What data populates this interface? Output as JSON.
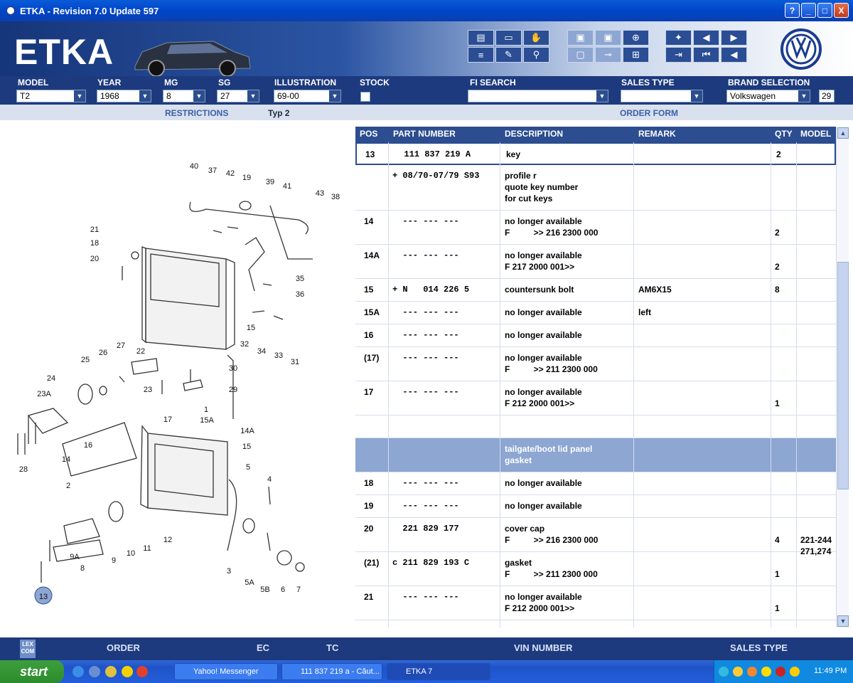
{
  "window": {
    "title": "ETKA - Revision 7.0 Update 597",
    "buttons": [
      "?",
      "_",
      "□",
      "X"
    ]
  },
  "header": {
    "logo": "ETKA"
  },
  "toolbar_icons": [
    "printer-icon",
    "monitor-icon",
    "handshake-icon",
    "list-icon",
    "pencil-icon",
    "bicycle-icon",
    "elsa-icon",
    "depot-icon",
    "cart-add-icon",
    "window-icon",
    "car-icon",
    "cart-icon",
    "pin-icon",
    "prev-page-icon",
    "page-icon",
    "next-page-icon",
    "first-icon",
    "back-icon",
    "left-icon"
  ],
  "fields": {
    "model": {
      "label": "MODEL",
      "value": "T2"
    },
    "year": {
      "label": "YEAR",
      "value": "1968"
    },
    "mg": {
      "label": "MG",
      "value": "8"
    },
    "sg": {
      "label": "SG",
      "value": "27"
    },
    "illustration": {
      "label": "ILLUSTRATION",
      "value": "69-00"
    },
    "stock": {
      "label": "STOCK"
    },
    "fi_search": {
      "label": "FI SEARCH",
      "value": ""
    },
    "sales_type": {
      "label": "SALES TYPE",
      "value": ""
    },
    "brand": {
      "label": "BRAND SELECTION",
      "value": "Volkswagen",
      "code": "29"
    }
  },
  "subbar": {
    "restrictions": "RESTRICTIONS",
    "type": "Typ 2",
    "order_form": "ORDER FORM"
  },
  "table": {
    "headers": [
      "POS",
      "PART NUMBER",
      "DESCRIPTION",
      "REMARK",
      "QTY",
      "MODEL"
    ],
    "rows": [
      {
        "pos": "13",
        "part": "  111 837 219 A",
        "desc": [
          "key"
        ],
        "remark": "",
        "qty": "2",
        "model": ""
      },
      {
        "pos": "",
        "part": "+ 08/70-07/79 S93",
        "desc": [
          "profile r",
          "quote key number",
          "for cut keys"
        ],
        "remark": "",
        "qty": "",
        "model": ""
      },
      {
        "pos": "14",
        "part": "  --- --- ---",
        "desc": [
          "no longer available",
          "F          >> 216 2300 000"
        ],
        "remark": "",
        "qty": "2",
        "model": ""
      },
      {
        "pos": "14A",
        "part": "  --- --- ---",
        "desc": [
          "no longer available",
          "F 217 2000 001>>"
        ],
        "remark": "",
        "qty": "2",
        "model": ""
      },
      {
        "pos": "15",
        "part": "+ N   014 226 5",
        "desc": [
          "countersunk bolt"
        ],
        "remark": "AM6X15",
        "qty": "8",
        "model": ""
      },
      {
        "pos": "15A",
        "part": "  --- --- ---",
        "desc": [
          "no longer available"
        ],
        "remark": "left",
        "qty": "",
        "model": ""
      },
      {
        "pos": "16",
        "part": "  --- --- ---",
        "desc": [
          "no longer available"
        ],
        "remark": "",
        "qty": "",
        "model": ""
      },
      {
        "pos": "(17)",
        "part": "  --- --- ---",
        "desc": [
          "no longer available",
          "F          >> 211 2300 000"
        ],
        "remark": "",
        "qty": "",
        "model": ""
      },
      {
        "pos": "17",
        "part": "  --- --- ---",
        "desc": [
          "no longer available",
          "F 212 2000 001>>"
        ],
        "remark": "",
        "qty": "1",
        "model": ""
      },
      {
        "pos": "",
        "part": "",
        "desc": [
          ""
        ],
        "remark": "",
        "qty": "",
        "model": ""
      },
      {
        "pos": "",
        "part": "",
        "desc": [
          "tailgate/boot lid panel",
          "gasket"
        ],
        "remark": "",
        "qty": "",
        "model": "",
        "header": true
      },
      {
        "pos": "18",
        "part": "  --- --- ---",
        "desc": [
          "no longer available"
        ],
        "remark": "",
        "qty": "",
        "model": ""
      },
      {
        "pos": "19",
        "part": "  --- --- ---",
        "desc": [
          "no longer available"
        ],
        "remark": "",
        "qty": "",
        "model": ""
      },
      {
        "pos": "20",
        "part": "  221 829 177",
        "desc": [
          "cover cap",
          "F          >> 216 2300 000"
        ],
        "remark": "",
        "qty": "4",
        "model": "221-244\n271,274"
      },
      {
        "pos": "(21)",
        "part": "c 211 829 193 C",
        "desc": [
          "gasket",
          "F          >> 211 2300 000"
        ],
        "remark": "",
        "qty": "1",
        "model": ""
      },
      {
        "pos": "21",
        "part": "  --- --- ---",
        "desc": [
          "no longer available",
          "F 212 2000 001>>"
        ],
        "remark": "",
        "qty": "1",
        "model": ""
      }
    ]
  },
  "illustration_labels": [
    "40",
    "37",
    "42",
    "19",
    "39",
    "41",
    "43",
    "38",
    "21",
    "18",
    "20",
    "35",
    "36",
    "15",
    "32",
    "34",
    "33",
    "31",
    "27",
    "26",
    "25",
    "22",
    "30",
    "24",
    "23A",
    "23",
    "29",
    "28",
    "17",
    "1",
    "15A",
    "14A",
    "15",
    "16",
    "14",
    "2",
    "5",
    "4",
    "9A",
    "8",
    "9",
    "10",
    "11",
    "12",
    "3",
    "5A",
    "5B",
    "6",
    "7",
    "13"
  ],
  "bottombar": {
    "order": "ORDER",
    "ec": "EC",
    "tc": "TC",
    "vin": "VIN NUMBER",
    "sales_type": "SALES TYPE",
    "lexcom": "LEX COM"
  },
  "taskbar": {
    "start": "start",
    "tasks": [
      "Yahoo! Messenger",
      "111 837 219 a - Căut...",
      "ETKA 7"
    ],
    "time": "11:49 PM"
  }
}
